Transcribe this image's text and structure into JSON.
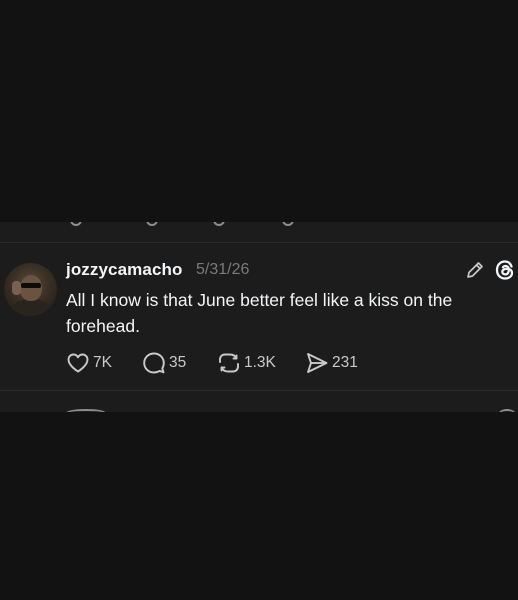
{
  "post": {
    "username": "jozzycamacho",
    "date": "5/31/26",
    "text": "All I know is that June better feel like a kiss on the forehead.",
    "avatar_icon": "profile-photo",
    "header_icons": [
      "edit-pencil-icon",
      "threads-logo-icon"
    ],
    "actions": {
      "like": {
        "icon": "heart-icon",
        "count": "7K"
      },
      "reply": {
        "icon": "comment-bubble-icon",
        "count": "35"
      },
      "repost": {
        "icon": "repost-icon",
        "count": "1.3K"
      },
      "share": {
        "icon": "send-icon",
        "count": "231"
      }
    }
  },
  "colors": {
    "background": "#121212",
    "card": "#1c1c1c",
    "text": "#f3f5f7",
    "muted": "#7a7a7a",
    "icon": "#c9c9c9"
  }
}
